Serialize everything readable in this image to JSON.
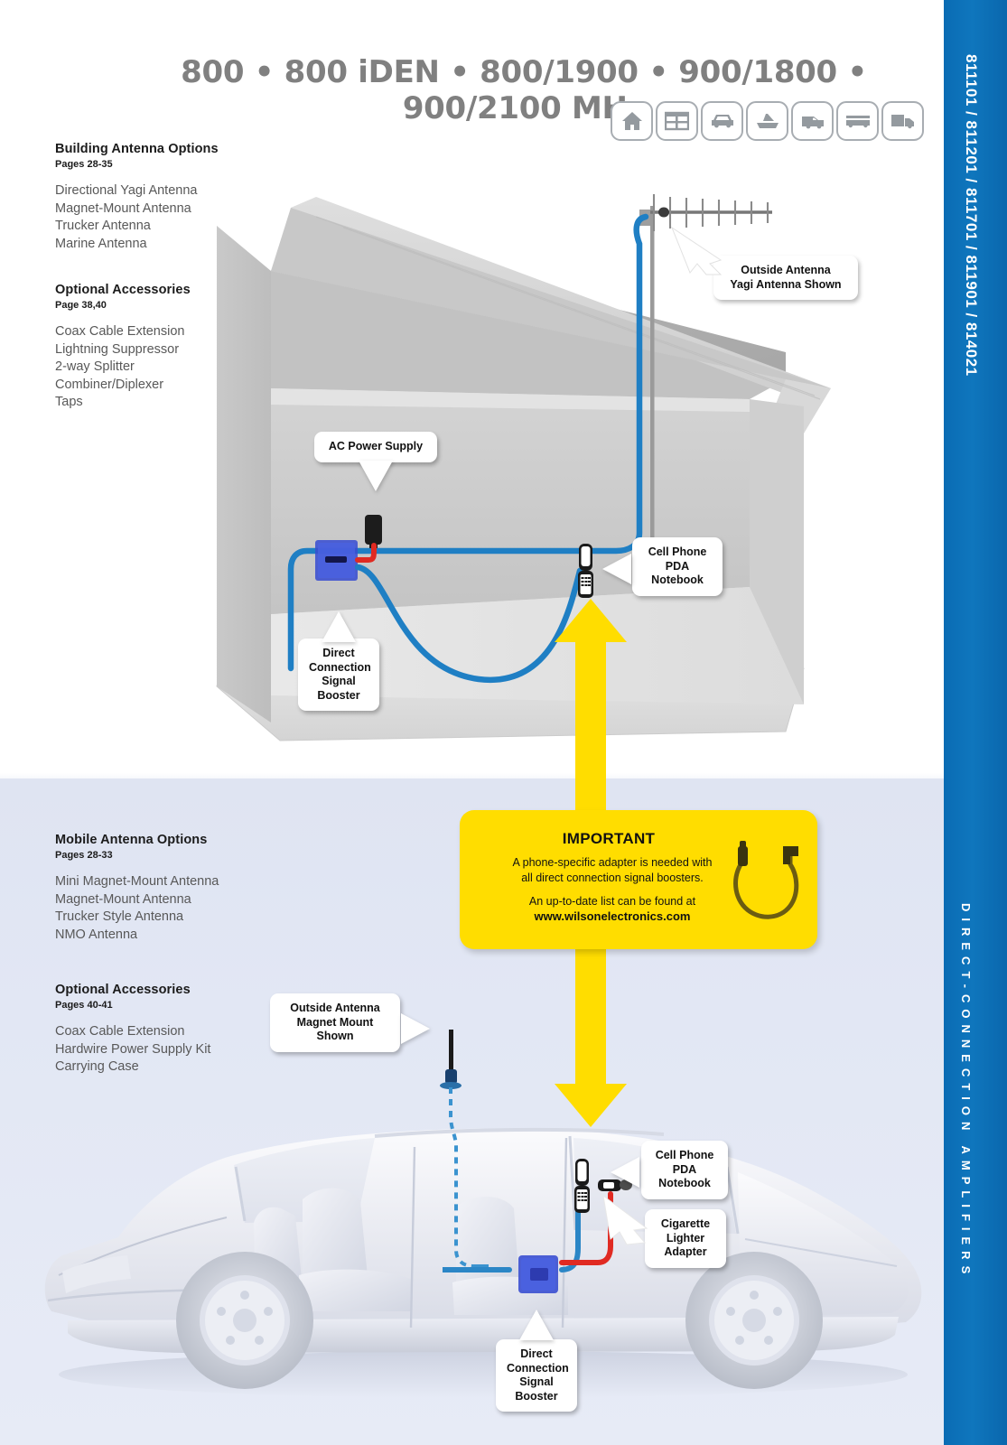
{
  "header": {
    "title": "800 • 800 iDEN • 800/1900 • 900/1800 • 900/2100 MHz",
    "icons": [
      {
        "name": "house-icon",
        "label": "Home"
      },
      {
        "name": "office-building-icon",
        "label": "Office"
      },
      {
        "name": "car-icon",
        "label": "Car"
      },
      {
        "name": "boat-icon",
        "label": "Boat"
      },
      {
        "name": "van-icon",
        "label": "Van"
      },
      {
        "name": "rv-icon",
        "label": "RV"
      },
      {
        "name": "truck-icon",
        "label": "Truck"
      }
    ]
  },
  "sidebar_right": {
    "part_numbers": "811101 / 811201 / 811701 / 811901 / 814021",
    "category": "DIRECT-CONNECTION AMPLIFIERS",
    "color": "#0f76bd"
  },
  "building_section": {
    "antenna_options": {
      "heading": "Building Antenna Options",
      "pages": "Pages 28-35",
      "items": [
        "Directional Yagi Antenna",
        "Magnet-Mount Antenna",
        "Trucker Antenna",
        "Marine Antenna"
      ]
    },
    "accessories": {
      "heading": "Optional Accessories",
      "pages": "Page 38,40",
      "items": [
        "Coax Cable Extension",
        "Lightning Suppressor",
        "2-way Splitter",
        "Combiner/Diplexer",
        "Taps"
      ]
    },
    "callouts": {
      "outside_antenna": "Outside Antenna\nYagi Antenna Shown",
      "outside_antenna_l1": "Outside Antenna",
      "outside_antenna_l2": "Yagi Antenna Shown",
      "ac_power_supply": "AC Power Supply",
      "booster_l1": "Direct",
      "booster_l2": "Connection",
      "booster_l3": "Signal",
      "booster_l4": "Booster",
      "device_l1": "Cell Phone",
      "device_l2": "PDA",
      "device_l3": "Notebook"
    }
  },
  "important": {
    "title": "IMPORTANT",
    "body_line_1": "A phone-specific adapter is needed with",
    "body_line_2": "all direct connection signal boosters.",
    "body_line_3": "An up-to-date list can be found at",
    "url": "www.wilsonelectronics.com",
    "background": "#FFDD00"
  },
  "mobile_section": {
    "antenna_options": {
      "heading": "Mobile Antenna Options",
      "pages": "Pages 28-33",
      "items": [
        "Mini Magnet-Mount Antenna",
        "Magnet-Mount Antenna",
        "Trucker Style Antenna",
        "NMO Antenna"
      ]
    },
    "accessories": {
      "heading": "Optional Accessories",
      "pages": "Pages 40-41",
      "items": [
        "Coax Cable Extension",
        "Hardwire Power Supply Kit",
        "Carrying Case"
      ]
    },
    "callouts": {
      "outside_antenna_l1": "Outside Antenna",
      "outside_antenna_l2": "Magnet Mount Shown",
      "device_l1": "Cell Phone",
      "device_l2": "PDA",
      "device_l3": "Notebook",
      "lighter_l1": "Cigarette",
      "lighter_l2": "Lighter",
      "lighter_l3": "Adapter",
      "booster_l1": "Direct",
      "booster_l2": "Connection",
      "booster_l3": "Signal",
      "booster_l4": "Booster"
    }
  },
  "colors": {
    "coax_blue": "#1f7fc4",
    "power_red": "#e02a22",
    "booster_blue": "#3a4fd0",
    "arrow_yellow": "#FFDD00",
    "heading_gray": "#808080"
  }
}
